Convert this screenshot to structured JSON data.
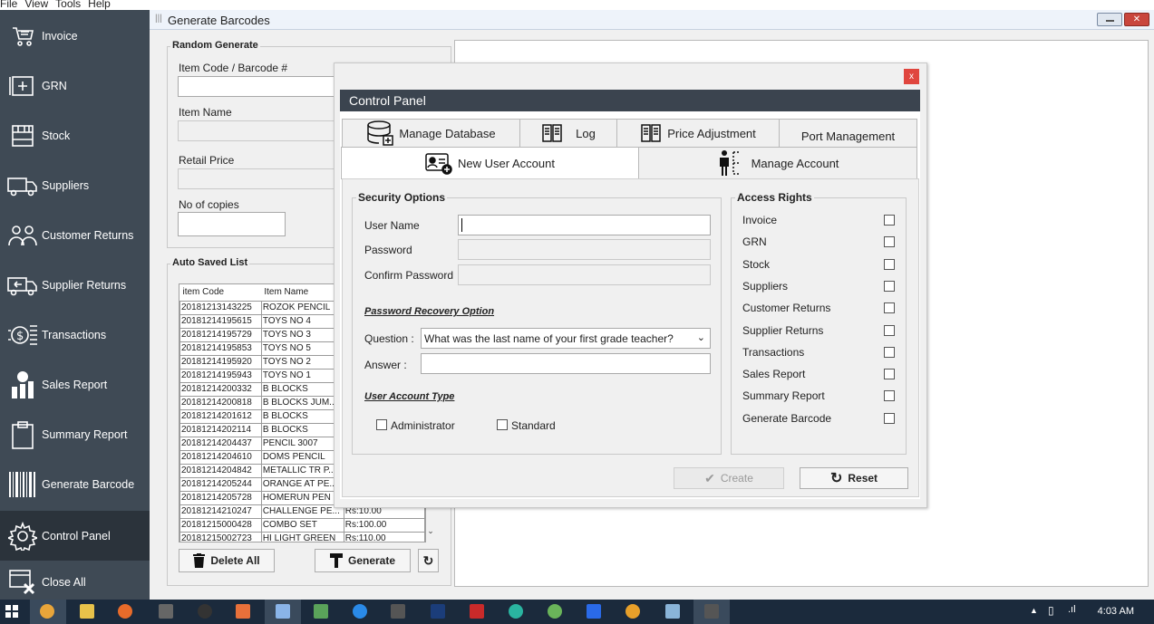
{
  "menubar": {
    "items": [
      "File",
      "View",
      "Tools",
      "Help"
    ]
  },
  "sidebar": {
    "items": [
      {
        "label": "Invoice",
        "icon": "cart-icon"
      },
      {
        "label": "GRN",
        "icon": "grn-icon"
      },
      {
        "label": "Stock",
        "icon": "stock-icon"
      },
      {
        "label": "Suppliers",
        "icon": "truck-icon"
      },
      {
        "label": "Customer Returns",
        "icon": "people-icon"
      },
      {
        "label": "Supplier Returns",
        "icon": "return-truck-icon"
      },
      {
        "label": "Transactions",
        "icon": "money-icon"
      },
      {
        "label": "Sales Report",
        "icon": "sales-chart-icon"
      },
      {
        "label": "Summary Report",
        "icon": "clipboard-icon"
      },
      {
        "label": "Generate Barcode",
        "icon": "barcode-icon"
      },
      {
        "label": "Control Panel",
        "icon": "gear-icon"
      },
      {
        "label": "Close All",
        "icon": "close-window-icon"
      }
    ]
  },
  "window": {
    "title": "Generate Barcodes"
  },
  "random_generate": {
    "group_title": "Random Generate",
    "item_code_label": "Item Code / Barcode #",
    "item_name_label": "Item Name",
    "retail_price_label": "Retail Price",
    "copies_label": "No of copies"
  },
  "auto_saved": {
    "group_title": "Auto Saved List",
    "columns": [
      "item Code",
      "Item Name"
    ],
    "rows": [
      [
        "20181213143225",
        "ROZOK PENCIL",
        ""
      ],
      [
        "20181214195615",
        "TOYS NO 4",
        ""
      ],
      [
        "20181214195729",
        "TOYS NO 3",
        ""
      ],
      [
        "20181214195853",
        "TOYS NO 5",
        ""
      ],
      [
        "20181214195920",
        "TOYS NO 2",
        ""
      ],
      [
        "20181214195943",
        "TOYS NO 1",
        ""
      ],
      [
        "20181214200332",
        "B BLOCKS",
        ""
      ],
      [
        "20181214200818",
        "B BLOCKS JUM...",
        ""
      ],
      [
        "20181214201612",
        "B BLOCKS",
        ""
      ],
      [
        "20181214202114",
        "B BLOCKS",
        ""
      ],
      [
        "20181214204437",
        "PENCIL 3007",
        ""
      ],
      [
        "20181214204610",
        "DOMS PENCIL",
        ""
      ],
      [
        "20181214204842",
        "METALLIC TR P...",
        ""
      ],
      [
        "20181214205244",
        "ORANGE AT PE...",
        ""
      ],
      [
        "20181214205728",
        "HOMERUN PEN",
        ""
      ],
      [
        "20181214210247",
        "CHALLENGE PE...",
        "Rs:10.00"
      ],
      [
        "20181215000428",
        "COMBO SET",
        "Rs:100.00"
      ],
      [
        "20181215002723",
        "HI LIGHT GREEN",
        "Rs:110.00"
      ]
    ]
  },
  "buttons": {
    "delete_all": "Delete All",
    "generate": "Generate"
  },
  "control_panel": {
    "title": "Control Panel",
    "close": "x",
    "tabs_row1": [
      "Manage Database",
      "Log",
      "Price Adjustment",
      "Port Management"
    ],
    "tabs_row2": [
      "New User Account",
      "Manage Account"
    ],
    "security": {
      "title": "Security Options",
      "username_label": "User Name",
      "password_label": "Password",
      "confirm_label": "Confirm Password",
      "recovery_title": "Password Recovery Option",
      "question_label": "Question :",
      "question_value": "What was the last name of your first grade teacher?",
      "answer_label": "Answer   :",
      "account_type_title": "User Account Type",
      "administrator": "Administrator",
      "standard": "Standard"
    },
    "access": {
      "title": "Access Rights",
      "items": [
        "Invoice",
        "GRN",
        "Stock",
        "Suppliers",
        "Customer Returns",
        "Supplier Returns",
        "Transactions",
        "Sales Report",
        "Summary Report",
        "Generate Barcode"
      ]
    },
    "create": "Create",
    "reset": "Reset"
  },
  "taskbar": {
    "time": "4:03 AM"
  }
}
